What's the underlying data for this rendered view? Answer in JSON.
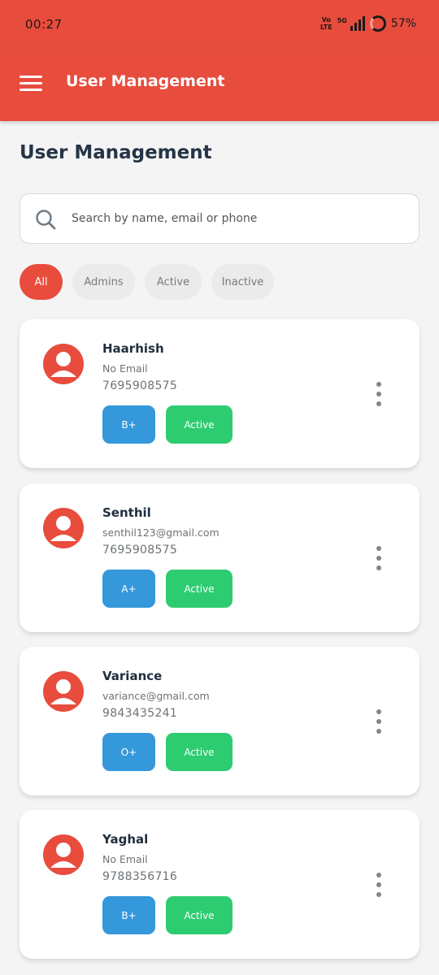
{
  "status_bar": {
    "time": "00:27",
    "volte_top": "Vo",
    "volte_bottom": "LTE",
    "network": "5G",
    "battery": "57%"
  },
  "app_bar": {
    "title": "User Management",
    "menu_icon": "hamburger-menu-icon"
  },
  "page": {
    "title": "User Management"
  },
  "search": {
    "placeholder": "Search by name, email or phone",
    "value": "",
    "icon": "search-icon"
  },
  "filters": [
    {
      "label": "All",
      "selected": true
    },
    {
      "label": "Admins",
      "selected": false
    },
    {
      "label": "Active",
      "selected": false
    },
    {
      "label": "Inactive",
      "selected": false
    }
  ],
  "users": [
    {
      "name": "Haarhish",
      "email": "No Email",
      "phone": "7695908575",
      "blood_group": "B+",
      "status": "Active"
    },
    {
      "name": "Senthil",
      "email": "senthil123@gmail.com",
      "phone": "7695908575",
      "blood_group": "A+",
      "status": "Active"
    },
    {
      "name": "Variance",
      "email": "variance@gmail.com",
      "phone": "9843435241",
      "blood_group": "O+",
      "status": "Active"
    },
    {
      "name": "Yaghal",
      "email": "No Email",
      "phone": "9788356716",
      "blood_group": "B+",
      "status": "Active"
    }
  ],
  "colors": {
    "primary": "#e84c3d",
    "blood_badge": "#3498db",
    "active_badge": "#2ecc71",
    "background": "#f4f4f4"
  }
}
